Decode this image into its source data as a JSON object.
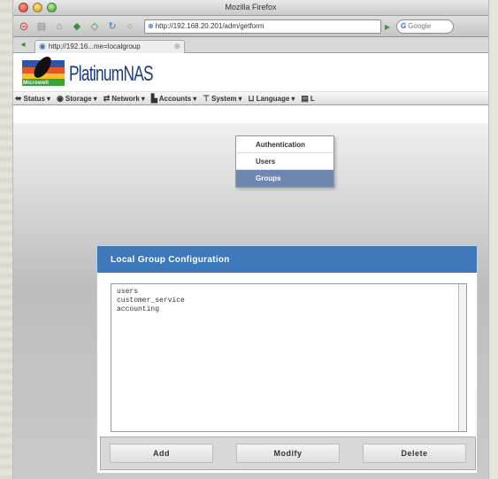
{
  "window": {
    "title": "Mozilla Firefox"
  },
  "toolbar": {
    "url": "http://192.168.20.201/adm/getform",
    "search_placeholder": "Google"
  },
  "tab": {
    "title": "http://192.16...me=localgroup"
  },
  "header": {
    "brand": "PlatinumNAS",
    "logo_label": "Microwell"
  },
  "menu": {
    "items": [
      {
        "label": "Status",
        "icon": "arrow-icon"
      },
      {
        "label": "Storage",
        "icon": "disk-icon"
      },
      {
        "label": "Network",
        "icon": "network-icon"
      },
      {
        "label": "Accounts",
        "icon": "accounts-icon"
      },
      {
        "label": "System",
        "icon": "system-icon"
      },
      {
        "label": "Language",
        "icon": "language-icon"
      },
      {
        "label": "L",
        "icon": "log-icon"
      }
    ]
  },
  "dropdown": {
    "items": [
      {
        "label": "Authentication"
      },
      {
        "label": "Users"
      },
      {
        "label": "Groups",
        "selected": true
      }
    ]
  },
  "panel": {
    "title": "Local Group Configuration",
    "groups": [
      "users",
      "customer_service",
      "accounting"
    ],
    "buttons": {
      "add": "Add",
      "modify": "Modify",
      "delete": "Delete"
    }
  },
  "colors": {
    "panel_header": "#3e78b8",
    "dropdown_selected": "#6d87b0",
    "brand": "#1b3b7a"
  }
}
